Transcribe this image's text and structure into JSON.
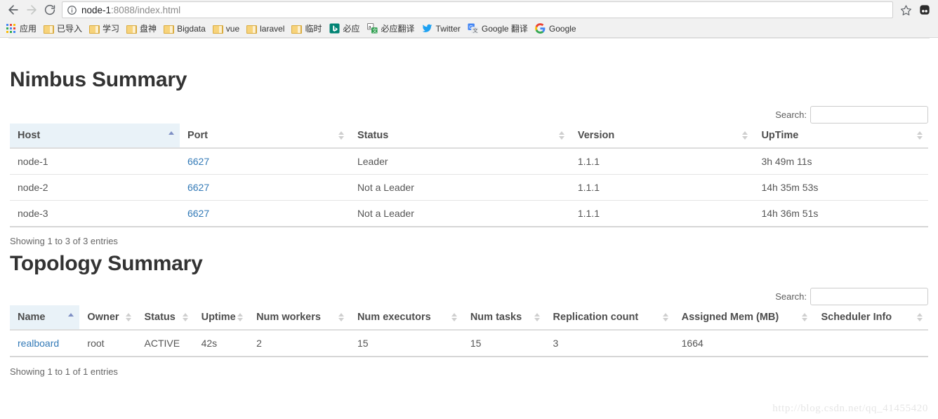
{
  "browser": {
    "back_tooltip": "Back",
    "forward_tooltip": "Forward",
    "reload_tooltip": "Reload",
    "url_host": "node-1",
    "url_rest": ":8088/index.html",
    "url_full": "node-1:8088/index.html",
    "bookmarks": [
      {
        "label": "应用",
        "icon": "apps-grid-icon"
      },
      {
        "label": "已导入",
        "icon": "folder-icon"
      },
      {
        "label": "学习",
        "icon": "folder-icon"
      },
      {
        "label": "盘神",
        "icon": "folder-icon"
      },
      {
        "label": "Bigdata",
        "icon": "folder-icon"
      },
      {
        "label": "vue",
        "icon": "folder-icon"
      },
      {
        "label": "laravel",
        "icon": "folder-icon"
      },
      {
        "label": "临时",
        "icon": "folder-icon"
      },
      {
        "label": "必应",
        "icon": "bing-icon"
      },
      {
        "label": "必应翻译",
        "icon": "bing-translate-icon"
      },
      {
        "label": "Twitter",
        "icon": "twitter-icon"
      },
      {
        "label": "Google 翻译",
        "icon": "google-translate-icon"
      },
      {
        "label": "Google",
        "icon": "google-icon"
      }
    ]
  },
  "nimbus": {
    "title": "Nimbus Summary",
    "search_label": "Search:",
    "search_value": "",
    "search_placeholder": "",
    "columns": [
      {
        "label": "Host",
        "sort": "asc"
      },
      {
        "label": "Port",
        "sort": "none"
      },
      {
        "label": "Status",
        "sort": "none"
      },
      {
        "label": "Version",
        "sort": "none"
      },
      {
        "label": "UpTime",
        "sort": "none"
      }
    ],
    "rows": [
      {
        "host": "node-1",
        "port": "6627",
        "status": "Leader",
        "version": "1.1.1",
        "uptime": "3h 49m 11s"
      },
      {
        "host": "node-2",
        "port": "6627",
        "status": "Not a Leader",
        "version": "1.1.1",
        "uptime": "14h 35m 53s"
      },
      {
        "host": "node-3",
        "port": "6627",
        "status": "Not a Leader",
        "version": "1.1.1",
        "uptime": "14h 36m 51s"
      }
    ],
    "info": "Showing 1 to 3 of 3 entries"
  },
  "topology": {
    "title": "Topology Summary",
    "search_label": "Search:",
    "search_value": "",
    "search_placeholder": "",
    "columns": [
      {
        "label": "Name",
        "sort": "asc"
      },
      {
        "label": "Owner",
        "sort": "none"
      },
      {
        "label": "Status",
        "sort": "none"
      },
      {
        "label": "Uptime",
        "sort": "none"
      },
      {
        "label": "Num workers",
        "sort": "none"
      },
      {
        "label": "Num executors",
        "sort": "none"
      },
      {
        "label": "Num tasks",
        "sort": "none"
      },
      {
        "label": "Replication count",
        "sort": "none"
      },
      {
        "label": "Assigned Mem (MB)",
        "sort": "none"
      },
      {
        "label": "Scheduler Info",
        "sort": "none"
      }
    ],
    "rows": [
      {
        "name": "realboard",
        "owner": "root",
        "status": "ACTIVE",
        "uptime": "42s",
        "num_workers": "2",
        "num_executors": "15",
        "num_tasks": "15",
        "replication_count": "3",
        "assigned_mem": "1664",
        "scheduler_info": ""
      }
    ],
    "info": "Showing 1 to 1 of 1 entries"
  },
  "watermark": "http://blog.csdn.net/qq_41455420",
  "colors": {
    "link": "#337ab7",
    "sorted_header_bg": "#e9f2f8",
    "sort_active_arrow": "#7e8fc4",
    "folder": "#f7d37b"
  }
}
